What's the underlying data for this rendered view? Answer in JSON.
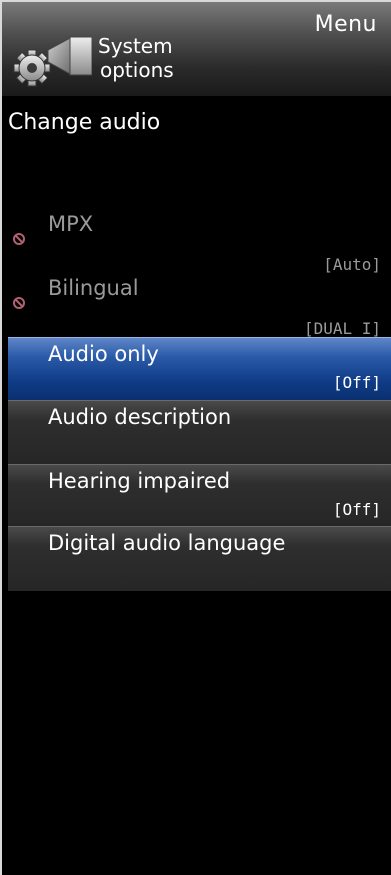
{
  "header": {
    "menu_label": "Menu",
    "section_title_line1": "System",
    "section_title_line2": "options",
    "icon": "gear-camera-icon"
  },
  "page_title": "Change audio",
  "items": [
    {
      "label": "MPX",
      "value": "[Auto]",
      "state": "disabled"
    },
    {
      "label": "Bilingual",
      "value": "[DUAL I]",
      "state": "disabled"
    },
    {
      "label": "Audio only",
      "value": "[Off]",
      "state": "selected"
    },
    {
      "label": "Audio description",
      "value": "",
      "state": "normal"
    },
    {
      "label": "Hearing impaired",
      "value": "[Off]",
      "state": "normal"
    },
    {
      "label": "Digital audio language",
      "value": "",
      "state": "normal"
    }
  ],
  "colors": {
    "selected": "#1a4a9a",
    "disabled_text": "#9a9a9a",
    "background": "#000000"
  }
}
